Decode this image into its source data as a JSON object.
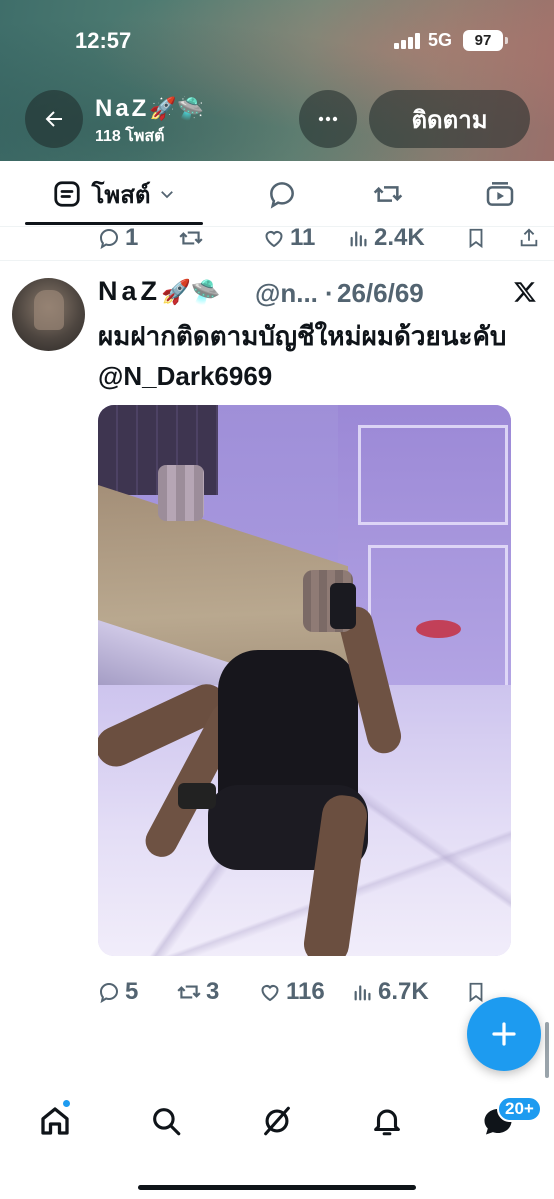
{
  "status_bar": {
    "time": "12:57",
    "network": "5G",
    "battery": "97"
  },
  "header": {
    "display_name": "NaZ",
    "name_emoji": "🚀🛸",
    "post_count": "118 โพสต์",
    "follow_label": "ติดตาม",
    "back_icon": "arrow-left-icon",
    "more_icon": "ellipsis-icon"
  },
  "tabs": [
    {
      "label": "โพสต์",
      "icon": "post-icon",
      "has_dropdown": true,
      "active": true
    },
    {
      "label": "",
      "icon": "reply-icon"
    },
    {
      "label": "",
      "icon": "repost-icon"
    },
    {
      "label": "",
      "icon": "media-icon"
    }
  ],
  "prev_tweet_actions": {
    "replies": "1",
    "reposts": "",
    "likes": "11",
    "views": "2.4K"
  },
  "tweet": {
    "display_name": "NaZ",
    "name_emoji": "🚀🛸",
    "handle": "@n...",
    "separator": "·",
    "date": "26/6/69",
    "text": "ผมฝากติดตามบัญชีใหม่ผมด้วยนะคับ @N_Dark6969",
    "actions": {
      "replies": "5",
      "reposts": "3",
      "likes": "116",
      "views": "6.7K"
    }
  },
  "fab": {
    "icon": "plus-icon"
  },
  "bottom_nav": {
    "items": [
      "home-icon",
      "search-icon",
      "grok-icon",
      "notifications-icon",
      "messages-icon"
    ],
    "messages_badge": "20+"
  },
  "colors": {
    "accent": "#1d9bf0",
    "text_primary": "#0f1419",
    "text_secondary": "#536471"
  }
}
